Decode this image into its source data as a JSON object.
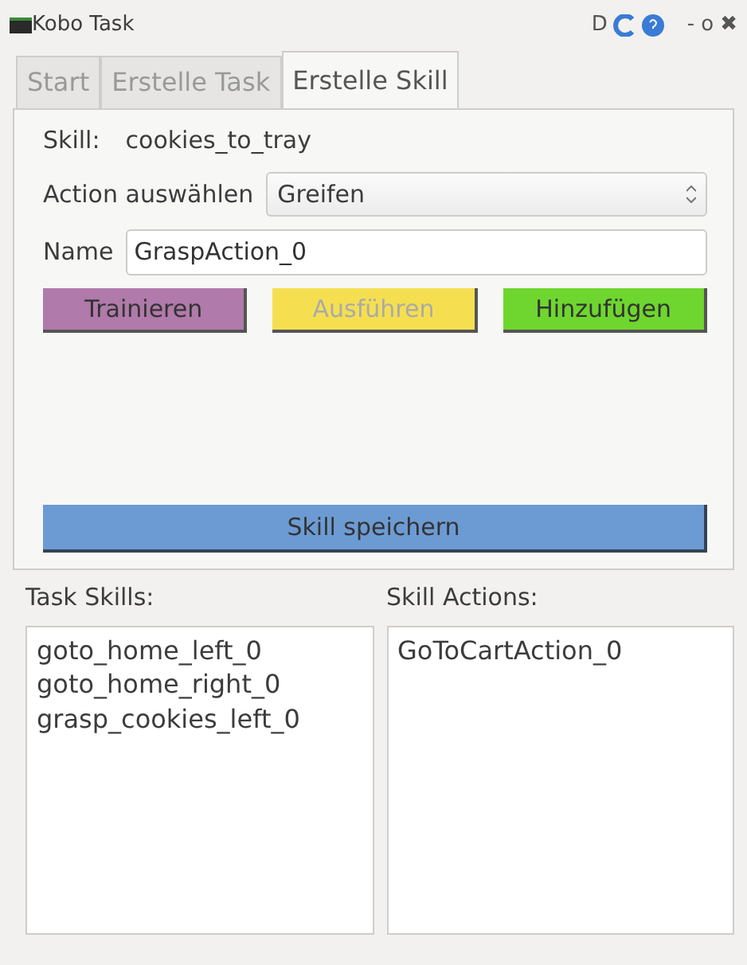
{
  "window": {
    "title": "Kobo Task",
    "controls": [
      "D",
      "-",
      "o",
      "✖"
    ]
  },
  "tabs": [
    {
      "label": "Start",
      "selected": false
    },
    {
      "label": "Erstelle Task",
      "selected": false
    },
    {
      "label": "Erstelle Skill",
      "selected": true
    }
  ],
  "skill": {
    "label": "Skill:",
    "value": "cookies_to_tray"
  },
  "action": {
    "label": "Action auswählen",
    "value": "Greifen"
  },
  "name": {
    "label": "Name",
    "value": "GraspAction_0"
  },
  "buttons": [
    {
      "label": "Trainieren",
      "color": "#b07aaa",
      "disabled": false
    },
    {
      "label": "Ausführen",
      "color": "#f5df50",
      "disabled": true
    },
    {
      "label": "Hinzufügen",
      "color": "#6ed62e",
      "disabled": false
    }
  ],
  "save_button": "Skill speichern",
  "task_skills": {
    "label": "Task Skills:",
    "items": [
      "goto_home_left_0",
      "goto_home_right_0",
      "grasp_cookies_left_0"
    ]
  },
  "skill_actions": {
    "label": "Skill Actions:",
    "items": [
      "GoToCartAction_0"
    ]
  }
}
